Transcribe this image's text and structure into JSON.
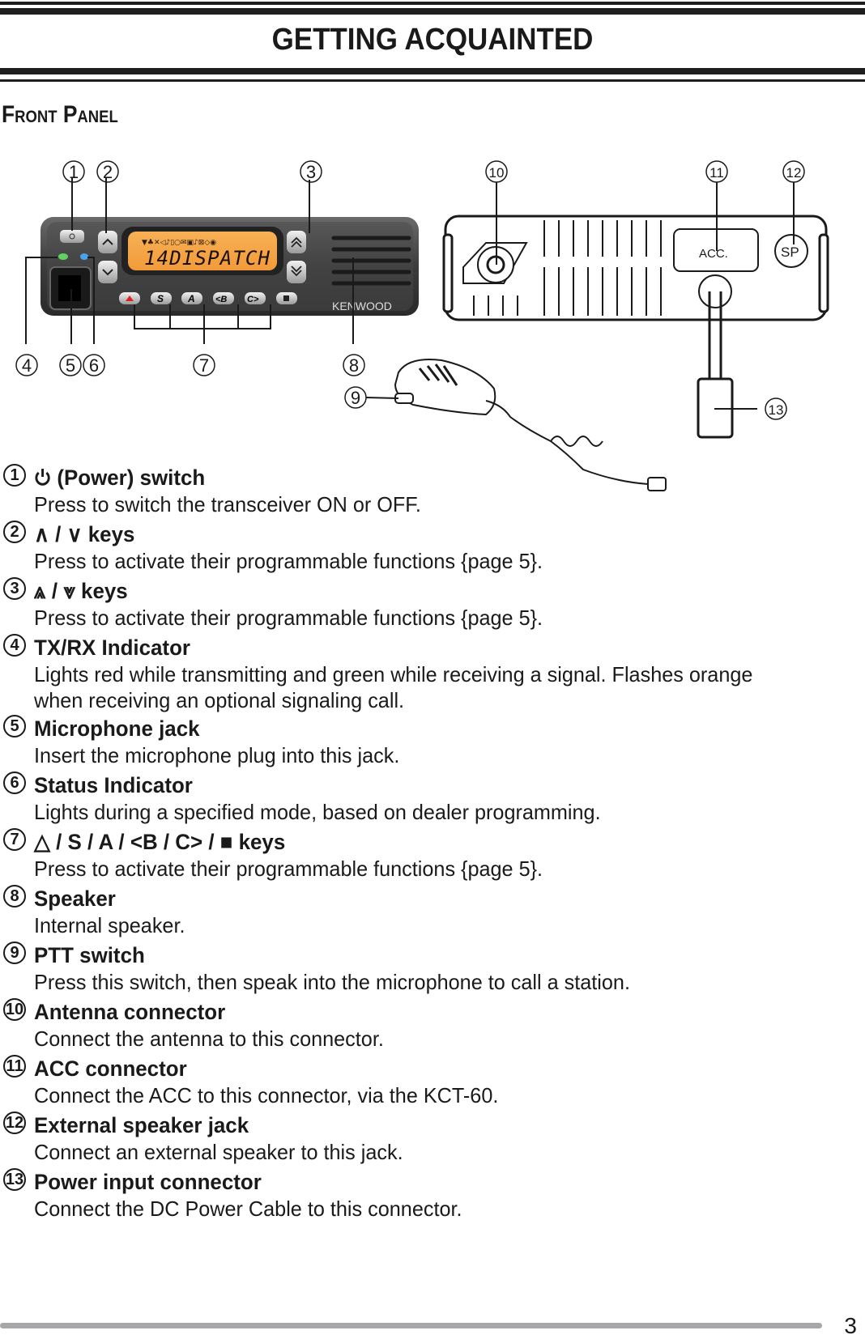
{
  "page": {
    "title": "GETTING ACQUAINTED",
    "section": "Front Panel",
    "page_number": "3"
  },
  "figure": {
    "callouts": [
      "1",
      "2",
      "3",
      "4",
      "5",
      "6",
      "7",
      "8",
      "9",
      "10",
      "11",
      "12",
      "13"
    ],
    "lcd_text": "14DISPATCH",
    "front_keys": [
      "▲",
      "S",
      "A",
      "<B",
      "C>",
      "■"
    ],
    "brand": "KENWOOD",
    "acc_label": "ACC.",
    "sp_label": "SP"
  },
  "items": [
    {
      "num": "1",
      "head_icon": "power-icon",
      "head": "(Power) switch",
      "desc": "Press to switch the transceiver ON or OFF."
    },
    {
      "num": "2",
      "head": "∧ / ∨ keys",
      "desc": "Press to activate their programmable functions {page 5}."
    },
    {
      "num": "3",
      "head": "⩓ / ⩔ keys",
      "desc": "Press to activate their programmable functions {page 5}."
    },
    {
      "num": "4",
      "head": "TX/RX Indicator",
      "desc": "Lights red while transmitting and green while receiving a signal.  Flashes orange when receiving an optional signaling call."
    },
    {
      "num": "5",
      "head": "Microphone jack",
      "desc": "Insert the microphone plug into this jack."
    },
    {
      "num": "6",
      "head": "Status Indicator",
      "desc": "Lights during a specified mode, based on dealer programming."
    },
    {
      "num": "7",
      "head": "△ / S / A / <B / C> / ■ keys",
      "desc": "Press to activate their programmable functions {page 5}."
    },
    {
      "num": "8",
      "head": "Speaker",
      "desc": "Internal speaker."
    },
    {
      "num": "9",
      "head": "PTT switch",
      "desc": "Press this switch, then speak into the microphone to call a station."
    },
    {
      "num": "10",
      "head": "Antenna connector",
      "desc": "Connect the antenna to this connector."
    },
    {
      "num": "11",
      "head": "ACC connector",
      "desc": "Connect the ACC to this connector, via the KCT-60."
    },
    {
      "num": "12",
      "head": "External speaker jack",
      "desc": "Connect an external speaker to this jack."
    },
    {
      "num": "13",
      "head": "Power input connector",
      "desc": "Connect the DC Power Cable to this connector."
    }
  ]
}
